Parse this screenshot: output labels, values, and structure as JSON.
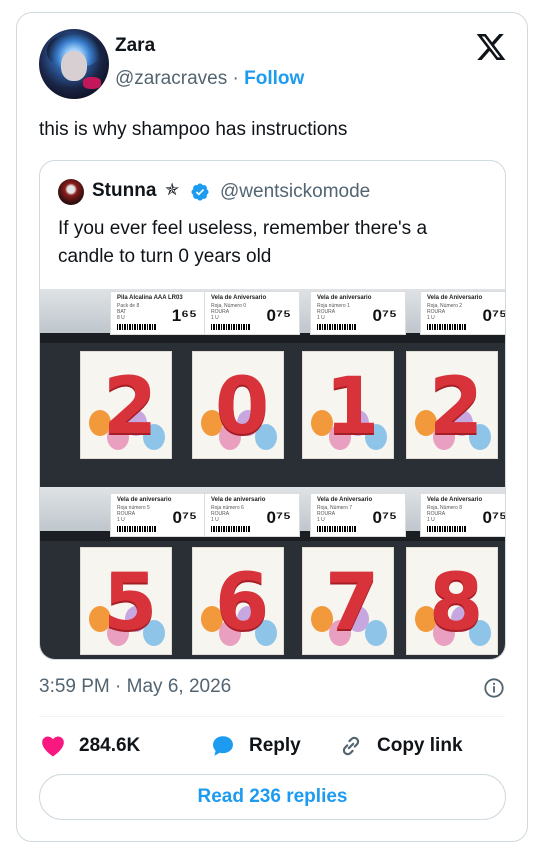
{
  "author": {
    "name": "Zara",
    "handle": "@zaracraves",
    "separator": "·",
    "follow_label": "Follow"
  },
  "tweet_text": "this is why shampoo has instructions",
  "quote": {
    "name": "Stunna",
    "emoji": "✯",
    "handle": "@wentsickomode",
    "text": "If you ever feel useless, remember there's a candle to turn 0 years old"
  },
  "photo": {
    "top_tags": [
      {
        "title": "Pila Alcalina AAA LR03",
        "lines": "Pack de 8\nBAT\n8 U",
        "price": "1⁶⁵"
      },
      {
        "title": "Vela de Aniversario",
        "lines": "Roja, Número 0\nROURA\n1 U",
        "price": "0⁷⁵"
      },
      {
        "title": "Vela de aniversario",
        "lines": "Roja número 1\nROURA\n1 U",
        "price": "0⁷⁵"
      },
      {
        "title": "Vela de Aniversario",
        "lines": "Roja, Número 2\nROURA\n1 U",
        "price": "0⁷⁵"
      }
    ],
    "bottom_tags": [
      {
        "title": "Vela de aniversario",
        "lines": "Roja número 5\nROURA\n1 U",
        "price": "0⁷⁵"
      },
      {
        "title": "Vela de aniversario",
        "lines": "Roja número 6\nROURA\n1 U",
        "price": "0⁷⁵"
      },
      {
        "title": "Vela de Aniversario",
        "lines": "Roja, Número 7\nROURA\n1 U",
        "price": "0⁷⁵"
      },
      {
        "title": "Vela de Aniversario",
        "lines": "Roja, Número 8\nROURA\n1 U",
        "price": "0⁷⁵"
      }
    ],
    "top_digits": [
      "2",
      "0",
      "1",
      "2"
    ],
    "bottom_digits": [
      "5",
      "6",
      "7",
      "8"
    ]
  },
  "timestamp": "3:59 PM · May 6, 2026",
  "actions": {
    "likes": "284.6K",
    "reply_label": "Reply",
    "copy_label": "Copy link"
  },
  "read_replies_label": "Read 236 replies",
  "colors": {
    "accent": "#1d9bf0",
    "like": "#f91880",
    "muted": "#536471"
  }
}
